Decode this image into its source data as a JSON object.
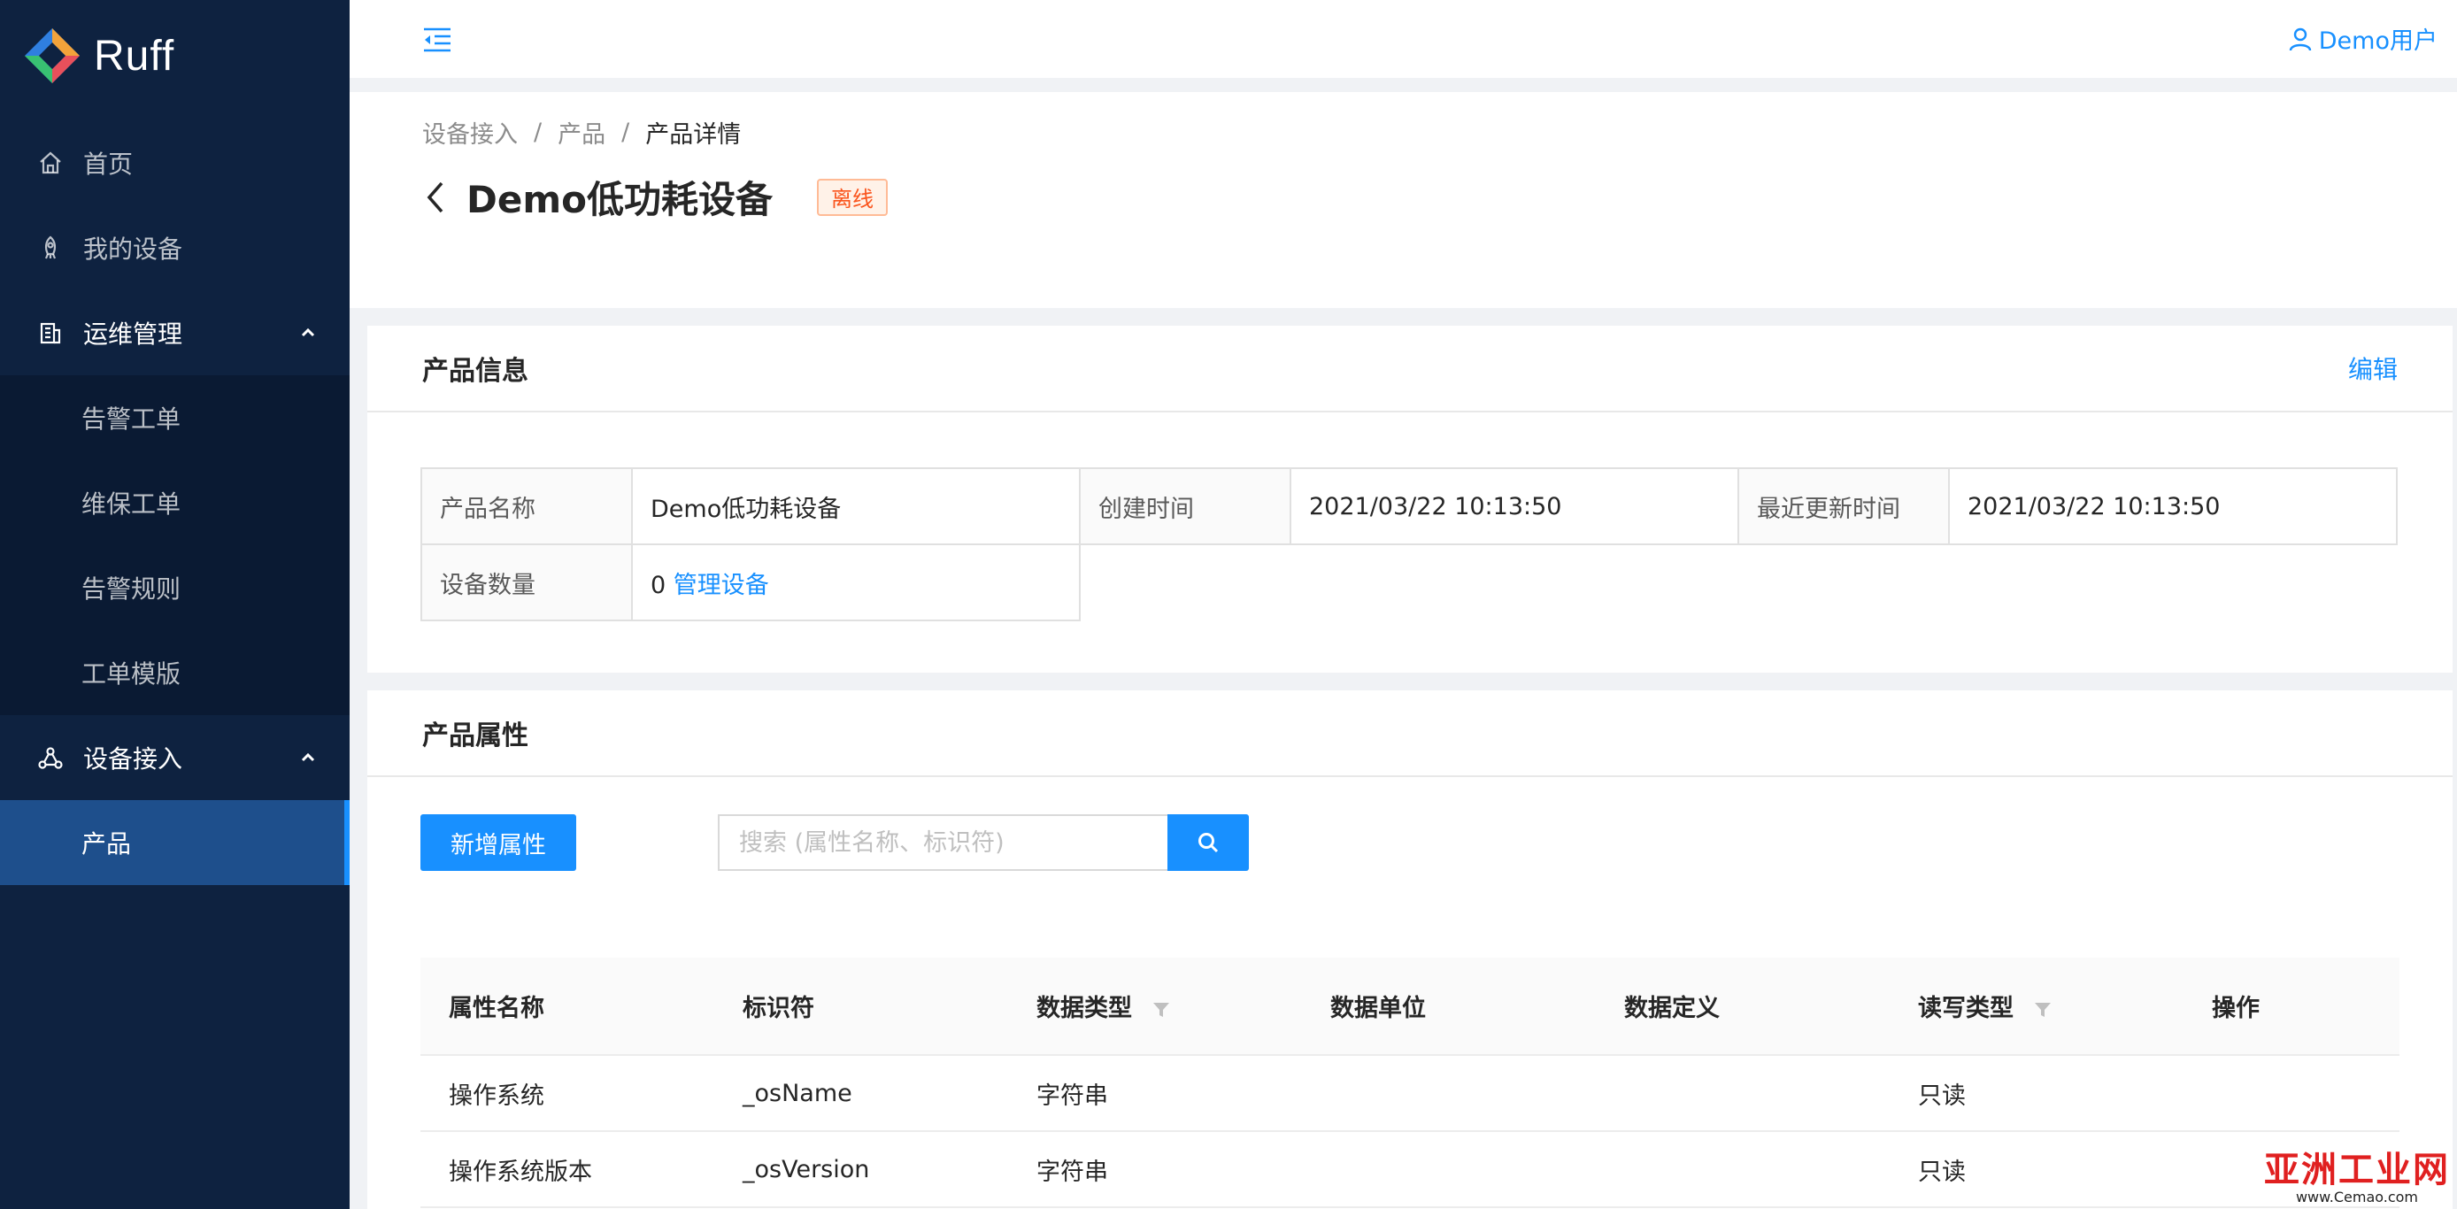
{
  "logo": {
    "text": "Ruff"
  },
  "sidebar": {
    "items": [
      {
        "label": "首页",
        "icon": "home-icon"
      },
      {
        "label": "我的设备",
        "icon": "rocket-icon"
      },
      {
        "label": "运维管理",
        "icon": "building-icon",
        "open": true,
        "children": [
          {
            "label": "告警工单"
          },
          {
            "label": "维保工单"
          },
          {
            "label": "告警规则"
          },
          {
            "label": "工单模版"
          }
        ]
      },
      {
        "label": "设备接入",
        "icon": "network-icon",
        "open": true,
        "children": [
          {
            "label": "产品",
            "selected": true
          }
        ]
      }
    ]
  },
  "header": {
    "user": "Demo用户"
  },
  "breadcrumb": [
    "设备接入",
    "产品",
    "产品详情"
  ],
  "page": {
    "title": "Demo低功耗设备",
    "status": "离线"
  },
  "product_info": {
    "title": "产品信息",
    "edit": "编辑",
    "rows": {
      "name_label": "产品名称",
      "name": "Demo低功耗设备",
      "created_label": "创建时间",
      "created": "2021/03/22 10:13:50",
      "updated_label": "最近更新时间",
      "updated": "2021/03/22 10:13:50",
      "count_label": "设备数量",
      "count": "0",
      "manage_link": "管理设备"
    }
  },
  "attributes": {
    "title": "产品属性",
    "add_button": "新增属性",
    "search_placeholder": "搜索 (属性名称、标识符)",
    "columns": [
      "属性名称",
      "标识符",
      "数据类型",
      "数据单位",
      "数据定义",
      "读写类型",
      "操作"
    ],
    "rows": [
      [
        "操作系统",
        "_osName",
        "字符串",
        "",
        "",
        "只读",
        ""
      ],
      [
        "操作系统版本",
        "_osVersion",
        "字符串",
        "",
        "",
        "只读",
        ""
      ]
    ]
  },
  "watermark": {
    "main": "亚洲工业网",
    "sub": "www.Cemao.com"
  },
  "colors": {
    "primary": "#1890ff",
    "sidebar": "#0e2240",
    "tag_text": "#fa541c"
  }
}
